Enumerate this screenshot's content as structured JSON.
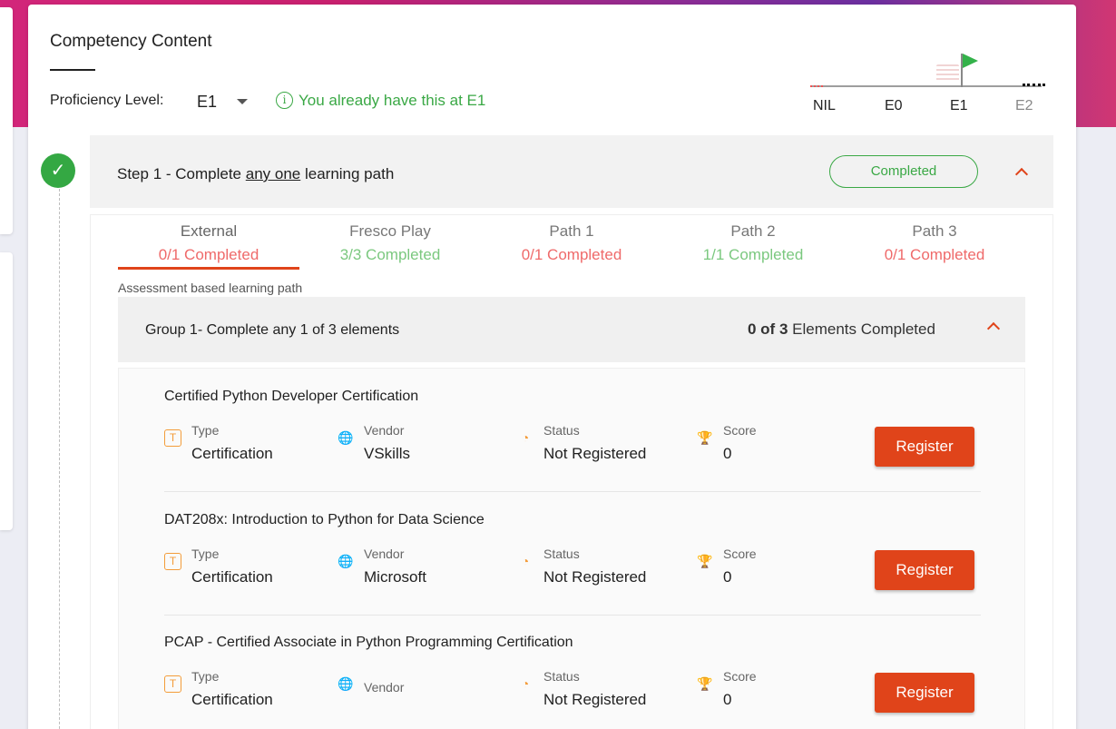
{
  "header": {
    "title": "Competency Content",
    "proficiency_label": "Proficiency Level:",
    "proficiency_value": "E1",
    "info_text": "You already have this at E1",
    "levels": [
      "NIL",
      "E0",
      "E1",
      "E2"
    ]
  },
  "step": {
    "title_prefix": "Step 1 - Complete ",
    "title_emphasis": "any one",
    "title_suffix": " learning path",
    "status": "Completed"
  },
  "tabs": [
    {
      "name": "External",
      "status": "0/1 Completed"
    },
    {
      "name": "Fresco Play",
      "status": "3/3 Completed"
    },
    {
      "name": "Path 1",
      "status": "0/1 Completed"
    },
    {
      "name": "Path 2",
      "status": "1/1 Completed"
    },
    {
      "name": "Path 3",
      "status": "0/1 Completed"
    }
  ],
  "path_description": "Assessment based learning path",
  "group": {
    "title": "Group 1- Complete any 1 of 3 elements",
    "count_bold": "0 of 3",
    "count_text": "Elements Completed"
  },
  "field_labels": {
    "type": "Type",
    "vendor": "Vendor",
    "status": "Status",
    "score": "Score"
  },
  "items": [
    {
      "title": "Certified Python Developer Certification",
      "type": "Certification",
      "vendor": "VSkills",
      "status": "Not Registered",
      "score": "0",
      "button": "Register"
    },
    {
      "title": "DAT208x: Introduction to Python for Data Science",
      "type": "Certification",
      "vendor": "Microsoft",
      "status": "Not Registered",
      "score": "0",
      "button": "Register"
    },
    {
      "title": "PCAP - Certified Associate in Python Programming Certification",
      "type": "Certification",
      "vendor": "",
      "status": "Not Registered",
      "score": "0",
      "button": "Register"
    }
  ],
  "colors": {
    "accent": "#e0441a",
    "success": "#3aa845"
  }
}
